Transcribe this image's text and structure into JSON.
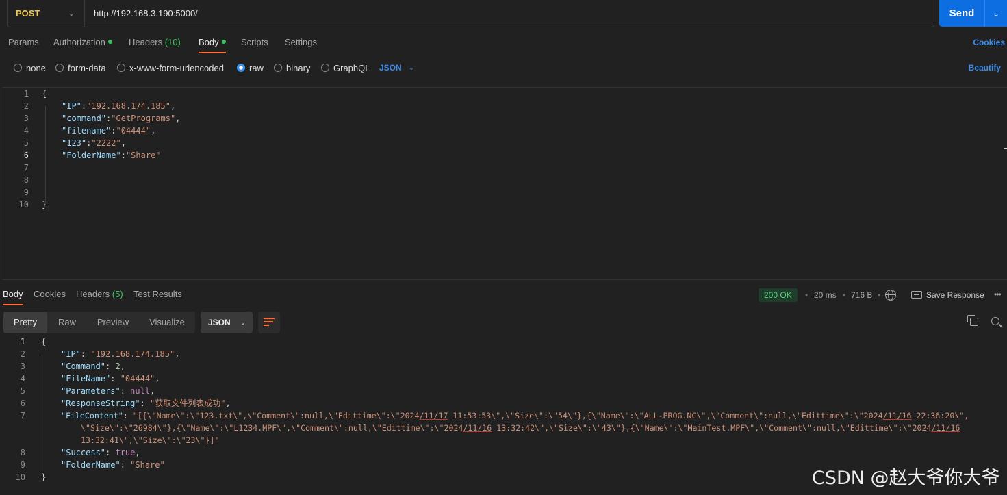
{
  "request": {
    "method": "POST",
    "url": "http://192.168.3.190:5000/",
    "send_label": "Send"
  },
  "request_tabs": {
    "params": "Params",
    "authorization": "Authorization",
    "headers": "Headers",
    "headers_count": "(10)",
    "body": "Body",
    "scripts": "Scripts",
    "settings": "Settings",
    "cookies": "Cookies"
  },
  "body_types": {
    "none": "none",
    "form_data": "form-data",
    "urlencoded": "x-www-form-urlencoded",
    "raw": "raw",
    "binary": "binary",
    "graphql": "GraphQL",
    "selected": "raw",
    "language": "JSON",
    "beautify": "Beautify"
  },
  "request_body": {
    "line_numbers": [
      "1",
      "2",
      "3",
      "4",
      "5",
      "6",
      "7",
      "8",
      "9",
      "10"
    ],
    "lines": [
      "{",
      "\"IP\":\"192.168.174.185\",",
      "\"command\":\"GetPrograms\",",
      "\"filename\":\"04444\",",
      "\"123\":\"2222\",",
      "\"FolderName\":\"Share\"",
      "",
      "",
      "",
      "}"
    ],
    "fields": [
      {
        "key": "\"IP\"",
        "value": "\"192.168.174.185\""
      },
      {
        "key": "\"command\"",
        "value": "\"GetPrograms\""
      },
      {
        "key": "\"filename\"",
        "value": "\"04444\""
      },
      {
        "key": "\"123\"",
        "value": "\"2222\""
      },
      {
        "key": "\"FolderName\"",
        "value": "\"Share\""
      }
    ]
  },
  "response_tabs": {
    "body": "Body",
    "cookies": "Cookies",
    "headers": "Headers",
    "headers_count": "(5)",
    "test_results": "Test Results"
  },
  "response_meta": {
    "status": "200 OK",
    "time": "20 ms",
    "size": "716 B",
    "save_response": "Save Response"
  },
  "view_modes": {
    "pretty": "Pretty",
    "raw": "Raw",
    "preview": "Preview",
    "visualize": "Visualize",
    "format": "JSON"
  },
  "response_body": {
    "line_numbers": [
      "1",
      "2",
      "3",
      "4",
      "5",
      "6",
      "7",
      "8",
      "9",
      "10"
    ],
    "ip_key": "\"IP\"",
    "ip_val": "\"192.168.174.185\"",
    "cmd_key": "\"Command\"",
    "cmd_val": "2",
    "fn_key": "\"FileName\"",
    "fn_val": "\"04444\"",
    "par_key": "\"Parameters\"",
    "par_val": "null",
    "rs_key": "\"ResponseString\"",
    "rs_val": "\"获取文件列表成功\"",
    "fc_key": "\"FileContent\"",
    "fc_l1a": "\"[{\\\"Name\\\":\\\"123.txt\\\",\\\"Comment\\\":null,\\\"Edittime\\\":\\\"2024",
    "fc_l1b": "/11/17",
    "fc_l1c": " 11:53:53\\\",\\\"Size\\\":\\\"54\\\"},{\\\"Name\\\":\\\"ALL-PROG.NC\\\",\\\"Comment\\\":null,\\\"Edittime\\\":\\\"2024",
    "fc_l1d": "/11/16",
    "fc_l1e": " 22:36:20\\\",",
    "fc_l2a": "\\\"Size\\\":\\\"26984\\\"},{\\\"Name\\\":\\\"L1234.MPF\\\",\\\"Comment\\\":null,\\\"Edittime\\\":\\\"2024",
    "fc_l2b": "/11/16",
    "fc_l2c": " 13:32:42\\\",\\\"Size\\\":\\\"43\\\"},{\\\"Name\\\":\\\"MainTest.MPF\\\",\\\"Comment\\\":null,\\\"Edittime\\\":\\\"2024",
    "fc_l2d": "/11/16",
    "fc_l3": "13:32:41\\\",\\\"Size\\\":\\\"23\\\"}]\"",
    "succ_key": "\"Success\"",
    "succ_val": "true",
    "fold_key": "\"FolderName\"",
    "fold_val": "\"Share\""
  },
  "watermark": "CSDN @赵大爷你大爷"
}
